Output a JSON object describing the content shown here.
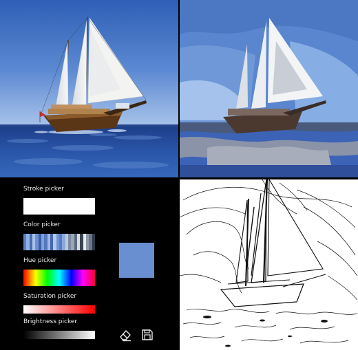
{
  "controls": {
    "stroke_label": "Stroke picker",
    "color_label": "Color picker",
    "hue_label": "Hue picker",
    "saturation_label": "Saturation picker",
    "brightness_label": "Brightness picker"
  },
  "stroke_color": "#ffffff",
  "selected_color": "#6a8fd0",
  "color_palette": [
    "#5c7fc0",
    "#8fb0e4",
    "#4a6db3",
    "#a8c2ec",
    "#6d90d2",
    "#3d5fa6",
    "#7ea0dc",
    "#5577bb",
    "#9db8e8",
    "#4466aa",
    "#b4c8ec",
    "#6f93d6",
    "#5a7cc0",
    "#8aa8e0",
    "#c0cad6",
    "#7a8aa0",
    "#9aa6b6",
    "#5d6a7c",
    "#d8dde4",
    "#3a4350",
    "#e8ecf0",
    "#8e98a6",
    "#6a7788",
    "#2e3644"
  ],
  "tools": {
    "eraser_icon": "eraser-icon",
    "save_icon": "floppy-disk-icon"
  },
  "images": {
    "original": "sailing ship photo",
    "posterized": "posterized sailing ship",
    "edges": "edge-detected sailing ship"
  }
}
